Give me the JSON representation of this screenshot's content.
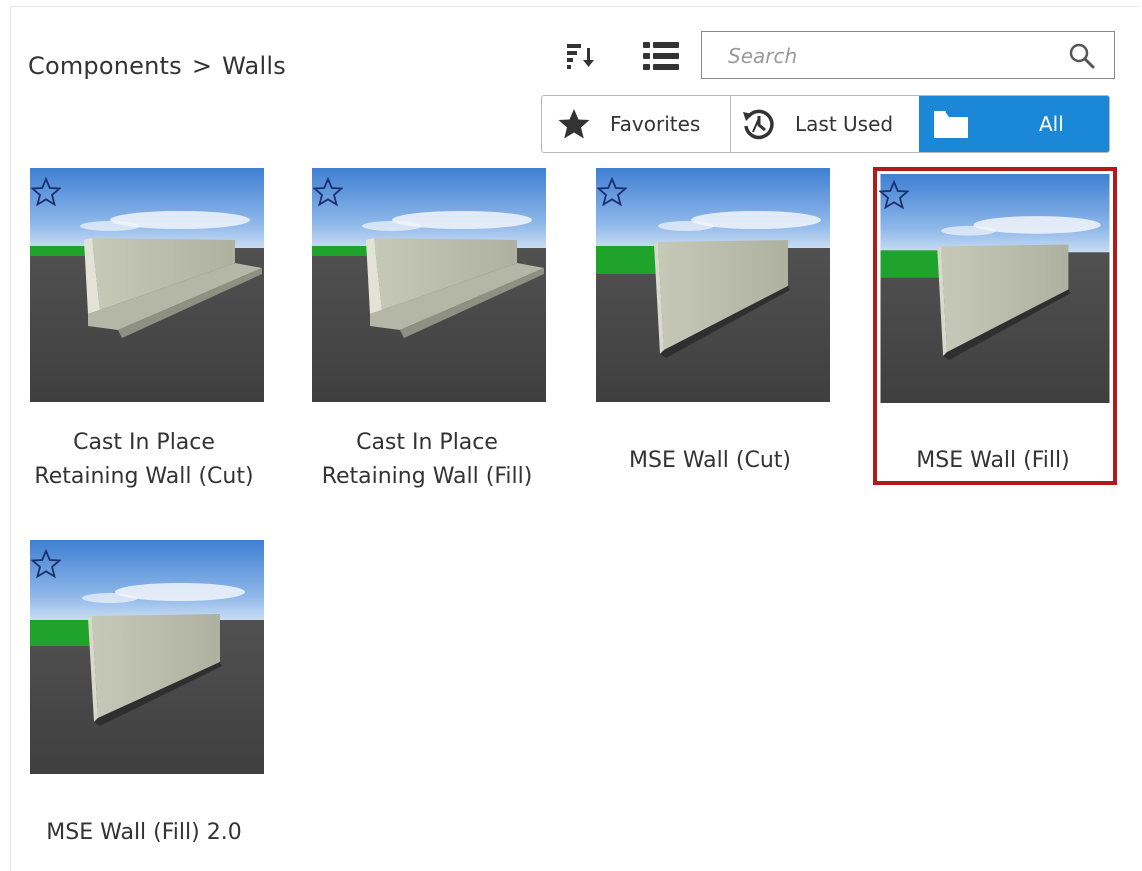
{
  "breadcrumb": {
    "root": "Components",
    "separator": ">",
    "current": "Walls"
  },
  "toolbar": {
    "sort_icon": "sort-icon",
    "list_view_icon": "list-view-icon"
  },
  "search": {
    "placeholder": "Search",
    "value": ""
  },
  "filters": [
    {
      "label": "Favorites",
      "icon": "star-icon",
      "active": false
    },
    {
      "label": "Last Used",
      "icon": "history-icon",
      "active": false
    },
    {
      "label": "All",
      "icon": "folder-icon",
      "active": true
    }
  ],
  "components": [
    {
      "name": "Cast In Place\nRetaining Wall (Cut)",
      "favorite": false,
      "selected": false
    },
    {
      "name": "Cast In Place\nRetaining Wall (Fill)",
      "favorite": false,
      "selected": false
    },
    {
      "name": "MSE Wall (Cut)",
      "favorite": false,
      "selected": false
    },
    {
      "name": "MSE Wall (Fill)",
      "favorite": false,
      "selected": true
    },
    {
      "name": "MSE Wall (Fill) 2.0",
      "favorite": false,
      "selected": false
    }
  ],
  "colors": {
    "accent": "#1a88d6",
    "selection": "#b01a1a",
    "sky": "#4f8fd8",
    "ground": "#4a4a4a",
    "grass": "#1fa32a"
  }
}
